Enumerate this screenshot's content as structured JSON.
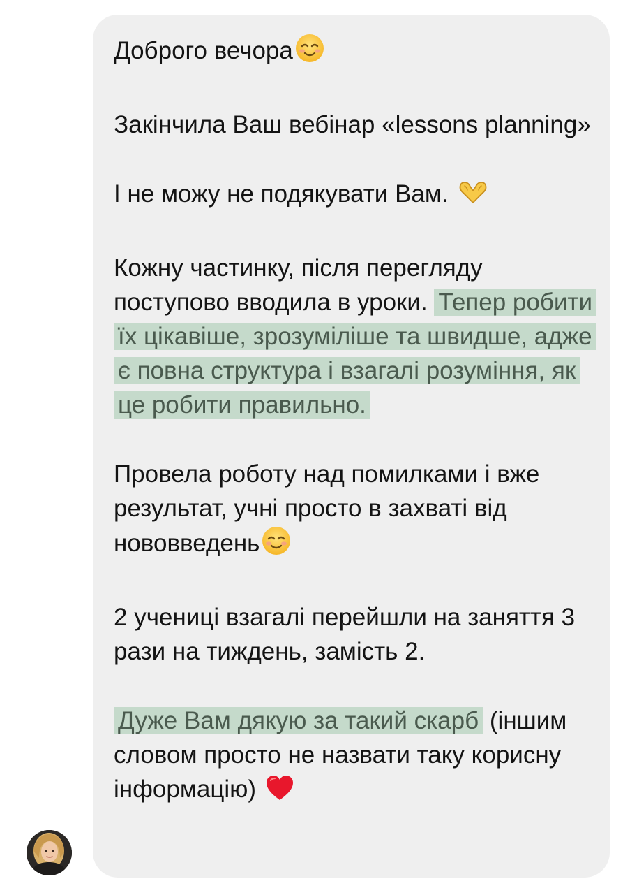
{
  "message": {
    "greeting": "Доброго вечора",
    "webinar_line": "Закінчила Ваш вебінар «lessons planning»",
    "thanks_line": "І не можу не подякувати Вам.",
    "progress_plain": "Кожну частинку, після перегляду поступово вводила в уроки.",
    "progress_highlight": "Тепер робити їх цікавіше, зрозуміліше та швидше, адже є повна структура і взагалі розуміння, як це робити правильно.",
    "results_line": "Провела роботу над помилками і вже результат, учні просто в захваті від нововведень",
    "students_line": "2 учениці взагалі перейшли на заняття 3 рази на тиждень, замість 2.",
    "closing_highlight": "Дуже Вам дякую за такий скарб",
    "closing_plain": "(іншим словом просто не назвати таку корисну інформацію)"
  },
  "icons": {
    "emoji_1": "smiling-face-icon",
    "emoji_2": "heart-hands-icon",
    "emoji_3": "smiling-face-icon",
    "emoji_4": "red-heart-icon"
  },
  "colors": {
    "bubble_background": "#efefef",
    "highlight_background": "#c5dacb",
    "highlight_text": "#4a5a4e",
    "text": "#141414",
    "heart": "#e8172c"
  }
}
